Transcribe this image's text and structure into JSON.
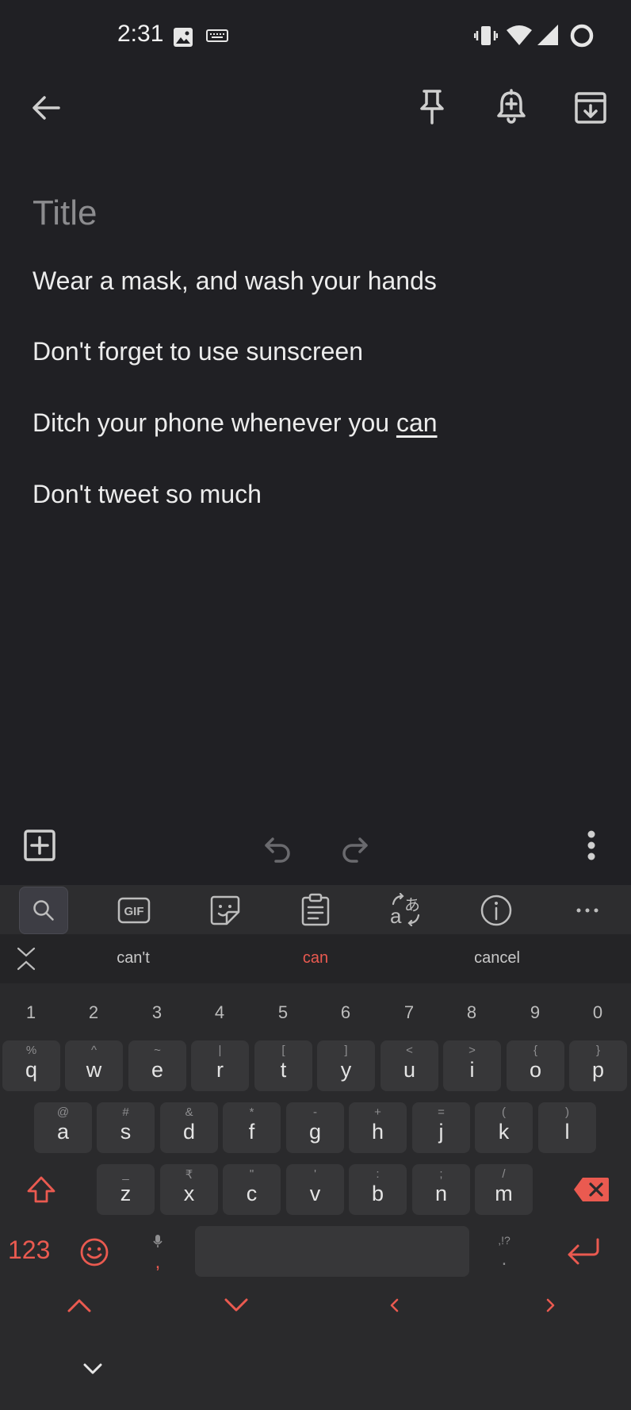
{
  "status_bar": {
    "time": "2:31"
  },
  "note": {
    "title_placeholder": "Title",
    "lines": [
      "Wear a mask, and wash your hands",
      "Don't forget to use sunscreen",
      "Ditch your phone whenever you ",
      "Don't tweet so much"
    ],
    "underlined_word": "can"
  },
  "suggestions": [
    "can't",
    "can",
    "cancel"
  ],
  "keyboard": {
    "numbers": [
      "1",
      "2",
      "3",
      "4",
      "5",
      "6",
      "7",
      "8",
      "9",
      "0"
    ],
    "row1": [
      [
        "%",
        "q"
      ],
      [
        "^",
        "w"
      ],
      [
        "~",
        "e"
      ],
      [
        "|",
        "r"
      ],
      [
        "[",
        "t"
      ],
      [
        "]",
        "y"
      ],
      [
        "<",
        "u"
      ],
      [
        ">",
        "i"
      ],
      [
        "{",
        "o"
      ],
      [
        "}",
        "p"
      ]
    ],
    "row2": [
      [
        "@",
        "a"
      ],
      [
        "#",
        "s"
      ],
      [
        "&",
        "d"
      ],
      [
        "*",
        "f"
      ],
      [
        "-",
        "g"
      ],
      [
        "+",
        "h"
      ],
      [
        "=",
        "j"
      ],
      [
        "(",
        "k"
      ],
      [
        ")",
        "l"
      ]
    ],
    "row3": [
      [
        "_",
        "z"
      ],
      [
        "₹",
        "x"
      ],
      [
        "\"",
        "c"
      ],
      [
        "'",
        "v"
      ],
      [
        ":",
        "b"
      ],
      [
        ";",
        "n"
      ],
      [
        "/",
        "m"
      ]
    ],
    "symbols_key": "123",
    "comma_key": ",",
    "period_hint": ",!?",
    "period_key": "."
  },
  "colors": {
    "accent": "#ea5a50",
    "background": "#202024",
    "keyboard_bg": "#2a2a2c"
  }
}
